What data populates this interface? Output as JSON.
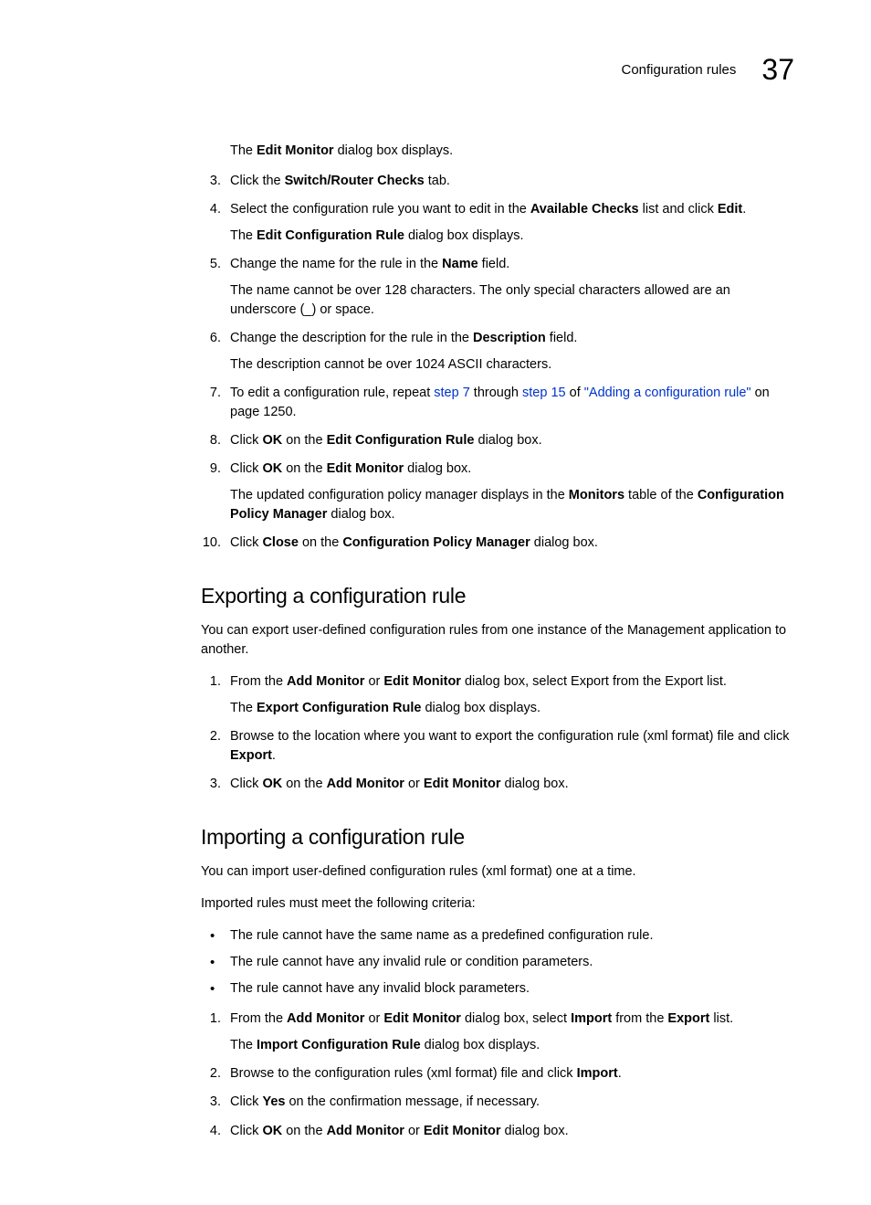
{
  "header": {
    "section_title": "Configuration rules",
    "chapter_number": "37"
  },
  "edit_section": {
    "pre_text": {
      "t1": "The ",
      "b1": "Edit Monitor",
      "t2": " dialog box displays."
    },
    "steps": [
      {
        "num": "3.",
        "t1": "Click the ",
        "b1": "Switch/Router Checks",
        "t2": " tab."
      },
      {
        "num": "4.",
        "t1": "Select the configuration rule you want to edit in the ",
        "b1": "Available Checks",
        "t2": " list and click ",
        "b2": "Edit",
        "t3": ".",
        "sub": {
          "t1": "The ",
          "b1": "Edit Configuration Rule",
          "t2": " dialog box displays."
        }
      },
      {
        "num": "5.",
        "t1": "Change the name for the rule in the ",
        "b1": "Name",
        "t2": " field.",
        "sub_plain": "The name cannot be over 128 characters. The only special characters allowed are an underscore (_) or space."
      },
      {
        "num": "6.",
        "t1": "Change the description for the rule in the ",
        "b1": "Description",
        "t2": " field.",
        "sub_plain": "The description cannot be over 1024 ASCII characters."
      },
      {
        "num": "7.",
        "t1": "To edit a configuration rule, repeat ",
        "link1": "step 7",
        "t2": " through ",
        "link2": "step 15",
        "t3": " of ",
        "link3": "\"Adding a configuration rule\"",
        "t4": " on page 1250."
      },
      {
        "num": "8.",
        "t1": "Click ",
        "b1": "OK",
        "t2": " on the ",
        "b2": "Edit Configuration Rule",
        "t3": " dialog box."
      },
      {
        "num": "9.",
        "t1": "Click ",
        "b1": "OK",
        "t2": " on the ",
        "b2": "Edit Monitor",
        "t3": " dialog box.",
        "sub": {
          "t1": "The updated configuration policy manager displays in the ",
          "b1": "Monitors",
          "t2": " table of the ",
          "b2": "Configuration Policy Manager",
          "t3": " dialog box."
        }
      },
      {
        "num": "10.",
        "t1": "Click ",
        "b1": "Close",
        "t2": " on the ",
        "b2": "Configuration Policy Manager",
        "t3": " dialog box."
      }
    ]
  },
  "export_section": {
    "heading": "Exporting a configuration rule",
    "intro": "You can export user-defined configuration rules from one instance of the Management application to another.",
    "steps": [
      {
        "num": "1.",
        "t1": "From the ",
        "b1": "Add Monitor",
        "t2": " or ",
        "b2": "Edit Monitor",
        "t3": " dialog box, select Export from the Export list.",
        "sub": {
          "t1": "The ",
          "b1": "Export Configuration Rule",
          "t2": " dialog box displays."
        }
      },
      {
        "num": "2.",
        "t1": "Browse to the location where you want to export the configuration rule (xml format) file and click ",
        "b1": "Export",
        "t2": "."
      },
      {
        "num": "3.",
        "t1": "Click ",
        "b1": "OK",
        "t2": " on the ",
        "b2": "Add Monitor",
        "t3": " or ",
        "b3": "Edit Monitor",
        "t4": " dialog box."
      }
    ]
  },
  "import_section": {
    "heading": "Importing a configuration rule",
    "intro1": "You can import user-defined configuration rules (xml format) one at a time.",
    "intro2": "Imported rules must meet the following criteria:",
    "bullets": [
      "The rule cannot have the same name as a predefined configuration rule.",
      "The rule cannot have any invalid rule or condition parameters.",
      "The rule cannot have any invalid block parameters."
    ],
    "steps": [
      {
        "num": "1.",
        "t1": "From the ",
        "b1": "Add Monitor",
        "t2": " or ",
        "b2": "Edit Monitor",
        "t3": " dialog box, select ",
        "b3": "Import",
        "t4": " from the ",
        "b4": "Export",
        "t5": " list.",
        "sub": {
          "t1": "The ",
          "b1": "Import Configuration Rule",
          "t2": " dialog box displays."
        }
      },
      {
        "num": "2.",
        "t1": "Browse to the configuration rules (xml format) file and click ",
        "b1": "Import",
        "t2": "."
      },
      {
        "num": "3.",
        "t1": "Click ",
        "b1": "Yes",
        "t2": " on the confirmation message, if necessary."
      },
      {
        "num": "4.",
        "t1": "Click ",
        "b1": "OK",
        "t2": " on the ",
        "b2": "Add Monitor",
        "t3": " or ",
        "b3": "Edit Monitor",
        "t4": " dialog box."
      }
    ]
  }
}
